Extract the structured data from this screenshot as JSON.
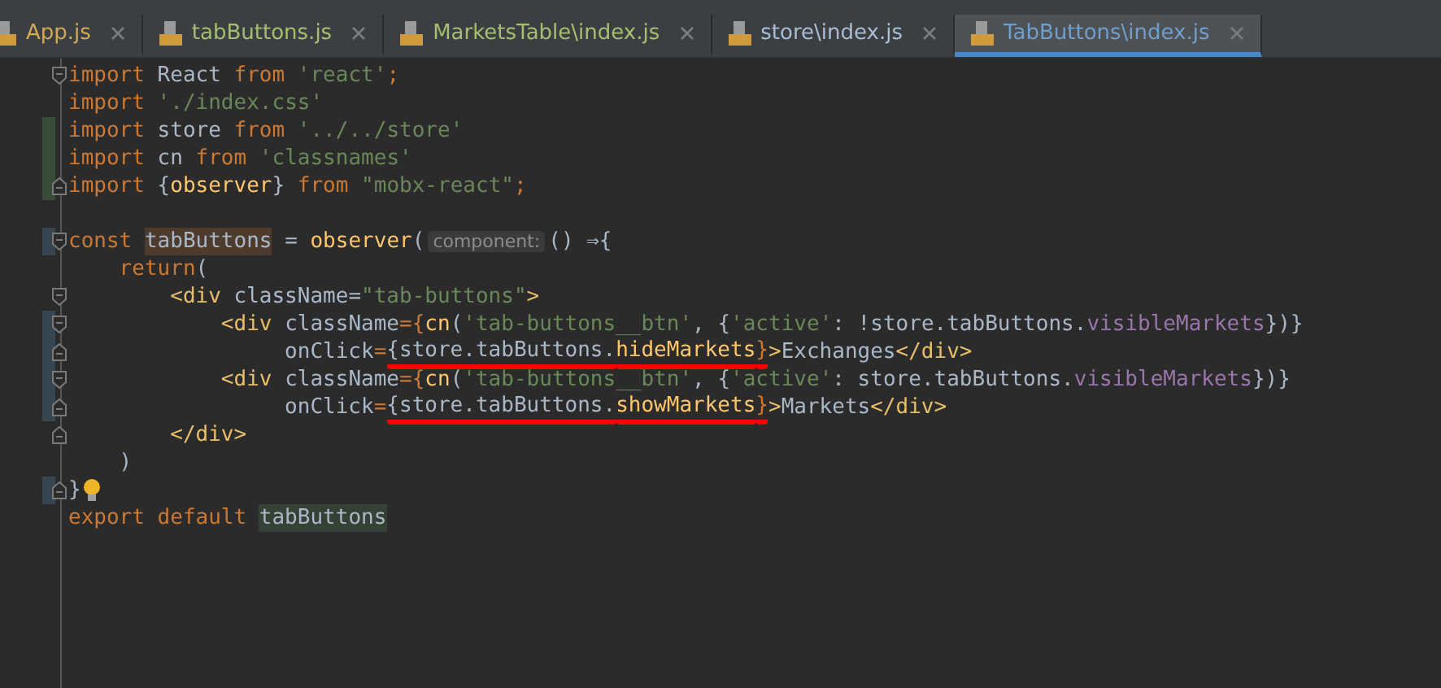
{
  "tabs": [
    {
      "label": "App.js",
      "selected": false,
      "color": "#d3a954"
    },
    {
      "label": "tabButtons.js",
      "selected": false,
      "color": "#a6bf6f"
    },
    {
      "label": "MarketsTable\\index.js",
      "selected": false,
      "color": "#a6bf6f"
    },
    {
      "label": "store\\index.js",
      "selected": false,
      "color": "#a9bcd6"
    },
    {
      "label": "TabButtons\\index.js",
      "selected": true,
      "color": "#6f9fd0"
    }
  ],
  "lines": [
    {
      "fold_start": true,
      "tokens": [
        {
          "kind": "keyword",
          "text": "import "
        },
        {
          "kind": "plain",
          "text": "React "
        },
        {
          "kind": "keyword",
          "text": "from "
        },
        {
          "kind": "string",
          "text": "'react'"
        },
        {
          "kind": "keyword",
          "text": ";"
        }
      ]
    },
    {
      "tokens": [
        {
          "kind": "keyword",
          "text": "import "
        },
        {
          "kind": "string",
          "text": "'./index.css'"
        }
      ]
    },
    {
      "added": true,
      "tokens": [
        {
          "kind": "keyword",
          "text": "import "
        },
        {
          "kind": "plain",
          "text": "store "
        },
        {
          "kind": "keyword",
          "text": "from "
        },
        {
          "kind": "string",
          "text": "'../../store'"
        }
      ]
    },
    {
      "added": true,
      "tokens": [
        {
          "kind": "keyword",
          "text": "import "
        },
        {
          "kind": "plain",
          "text": "cn "
        },
        {
          "kind": "keyword",
          "text": "from "
        },
        {
          "kind": "string",
          "text": "'classnames'"
        }
      ]
    },
    {
      "added": true,
      "fold_end": true,
      "tokens": [
        {
          "kind": "keyword",
          "text": "import "
        },
        {
          "kind": "plain",
          "text": "{"
        },
        {
          "kind": "function",
          "text": "observer"
        },
        {
          "kind": "plain",
          "text": "} "
        },
        {
          "kind": "keyword",
          "text": "from "
        },
        {
          "kind": "string",
          "text": "\"mobx-react\""
        },
        {
          "kind": "keyword",
          "text": ";"
        }
      ]
    },
    {
      "space_before": true,
      "modified": true,
      "fold_start": true,
      "tokens": [
        {
          "kind": "keyword",
          "text": "const "
        },
        {
          "kind": "definition",
          "text": "tabButtons"
        },
        {
          "kind": "plain",
          "text": " = "
        },
        {
          "kind": "function",
          "text": "observer"
        },
        {
          "kind": "plain",
          "text": "("
        },
        {
          "kind": "hint",
          "text": "component:"
        },
        {
          "kind": "plain",
          "text": "() ⇒{"
        }
      ]
    },
    {
      "tokens": [
        {
          "kind": "keyword",
          "text": "    return"
        },
        {
          "kind": "plain",
          "text": "("
        }
      ]
    },
    {
      "fold_start": true,
      "tokens": [
        {
          "kind": "tag",
          "text": "        <div "
        },
        {
          "kind": "plain",
          "text": "className"
        },
        {
          "kind": "plain",
          "text": "="
        },
        {
          "kind": "string",
          "text": "\"tab-buttons\""
        },
        {
          "kind": "tag",
          "text": ">"
        }
      ]
    },
    {
      "modified": true,
      "fold_start": true,
      "tokens": [
        {
          "kind": "tag",
          "text": "            <div "
        },
        {
          "kind": "plain",
          "text": "className"
        },
        {
          "kind": "keyword",
          "text": "={"
        },
        {
          "kind": "function",
          "text": "cn"
        },
        {
          "kind": "plain",
          "text": "("
        },
        {
          "kind": "string",
          "text": "'tab-buttons__btn'"
        },
        {
          "kind": "plain",
          "text": ", {"
        },
        {
          "kind": "string",
          "text": "'active'"
        },
        {
          "kind": "plain",
          "text": ": !store.tabButtons."
        },
        {
          "kind": "property",
          "text": "visibleMarkets"
        },
        {
          "kind": "plain",
          "text": "})}"
        }
      ]
    },
    {
      "modified": true,
      "fold_end": true,
      "tokens": [
        {
          "kind": "plain",
          "text": "                 onClick"
        },
        {
          "kind": "keyword",
          "text": "="
        },
        {
          "kind": "plain",
          "text": "{store.tabButtons.",
          "underlined": true
        },
        {
          "kind": "function",
          "text": "hideMarkets",
          "underlined": true
        },
        {
          "kind": "keyword",
          "text": "}",
          "underlined": true
        },
        {
          "kind": "tag",
          "text": ">"
        },
        {
          "kind": "plain",
          "text": "Exchanges"
        },
        {
          "kind": "tag",
          "text": "</div>"
        }
      ]
    },
    {
      "modified": true,
      "fold_start": true,
      "tokens": [
        {
          "kind": "tag",
          "text": "            <div "
        },
        {
          "kind": "plain",
          "text": "className"
        },
        {
          "kind": "keyword",
          "text": "={"
        },
        {
          "kind": "function",
          "text": "cn"
        },
        {
          "kind": "plain",
          "text": "("
        },
        {
          "kind": "string",
          "text": "'tab-buttons__btn'"
        },
        {
          "kind": "plain",
          "text": ", {"
        },
        {
          "kind": "string",
          "text": "'active'"
        },
        {
          "kind": "plain",
          "text": ": store.tabButtons."
        },
        {
          "kind": "property",
          "text": "visibleMarkets"
        },
        {
          "kind": "plain",
          "text": "})}"
        }
      ]
    },
    {
      "modified": true,
      "fold_end": true,
      "tokens": [
        {
          "kind": "plain",
          "text": "                 onClick"
        },
        {
          "kind": "keyword",
          "text": "="
        },
        {
          "kind": "plain",
          "text": "{store.tabButtons.",
          "underlined": true
        },
        {
          "kind": "function",
          "text": "showMarkets",
          "underlined": true
        },
        {
          "kind": "keyword",
          "text": "}",
          "underlined": true
        },
        {
          "kind": "tag",
          "text": ">"
        },
        {
          "kind": "plain",
          "text": "Markets"
        },
        {
          "kind": "tag",
          "text": "</div>"
        }
      ]
    },
    {
      "fold_end": true,
      "tokens": [
        {
          "kind": "tag",
          "text": "        </div>"
        }
      ]
    },
    {
      "tokens": [
        {
          "kind": "plain",
          "text": "    )"
        }
      ]
    },
    {
      "modified": true,
      "fold_end": true,
      "tokens": [
        {
          "kind": "plain",
          "text": "}"
        },
        {
          "kind": "bulb"
        }
      ]
    },
    {
      "tokens": [
        {
          "kind": "keyword",
          "text": "export default "
        },
        {
          "kind": "usage",
          "text": "tabButtons"
        }
      ]
    }
  ]
}
